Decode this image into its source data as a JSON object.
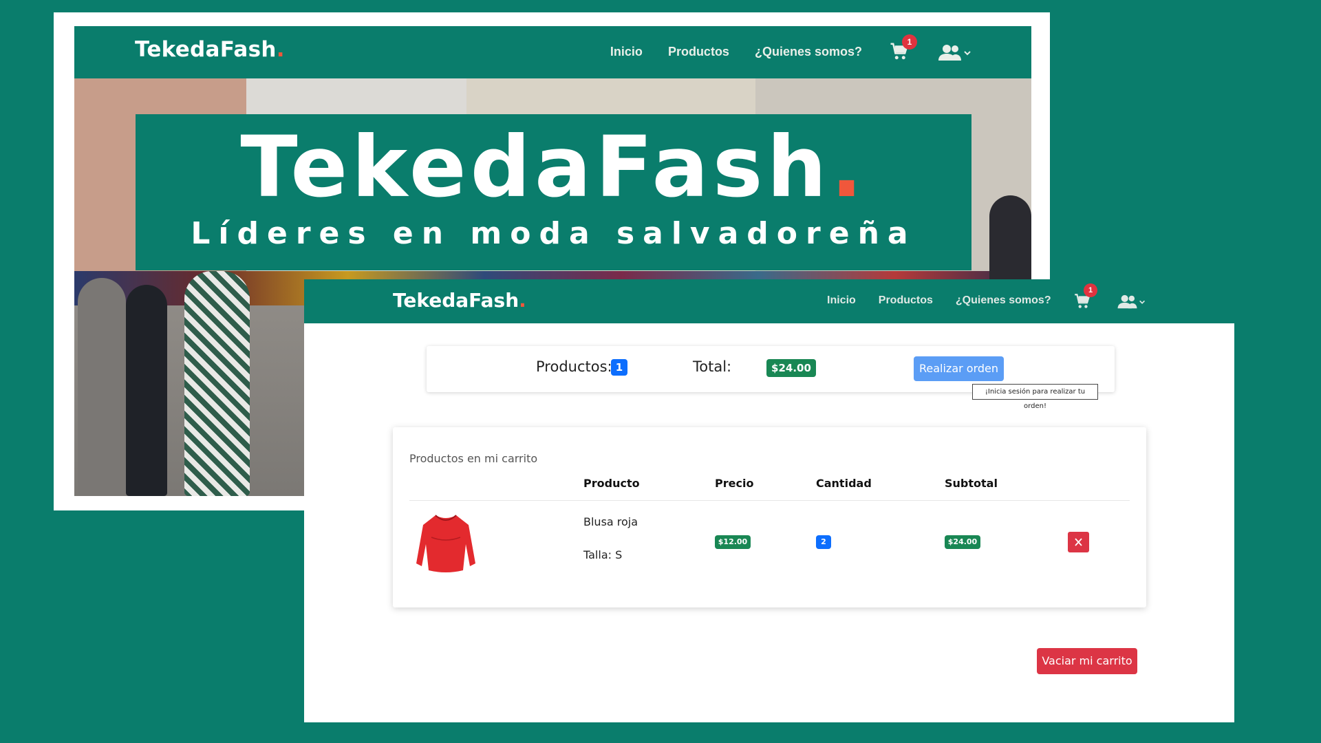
{
  "back_window": {
    "brand": "TekedaFash",
    "brand_dot": ".",
    "nav": [
      "Inicio",
      "Productos",
      "¿Quienes somos?"
    ],
    "cart_count": "1",
    "hero_title": "TekedaFash",
    "hero_title_dot": ".",
    "hero_tagline": "Líderes en moda salvadoreña"
  },
  "front_window": {
    "brand": "TekedaFash",
    "brand_dot": ".",
    "nav": [
      "Inicio",
      "Productos",
      "¿Quienes somos?"
    ],
    "cart_count": "1",
    "summary": {
      "products_label": "Productos:",
      "products_count": "1",
      "total_label": "Total:",
      "total_value": "$24.00",
      "order_button": "Realizar orden",
      "tooltip": "¡Inicia sesión para realizar tu orden!"
    },
    "cart": {
      "caption": "Productos en mi carrito",
      "headers": [
        "Producto",
        "Precio",
        "Cantidad",
        "Subtotal"
      ],
      "rows": [
        {
          "name": "Blusa roja",
          "size": "Talla: S",
          "price": "$12.00",
          "quantity": "2",
          "subtotal": "$24.00"
        }
      ]
    },
    "empty_button": "Vaciar mi carrito"
  },
  "icons": [
    "cart-icon",
    "users-icon",
    "chevron-down-icon",
    "close-icon"
  ],
  "colors": {
    "brand_green": "#0a7d6c",
    "accent_dot": "#f0573b",
    "badge_red": "#e0333f",
    "primary_blue": "#0d6efd",
    "success_green": "#198754",
    "danger_red": "#dc3545"
  }
}
